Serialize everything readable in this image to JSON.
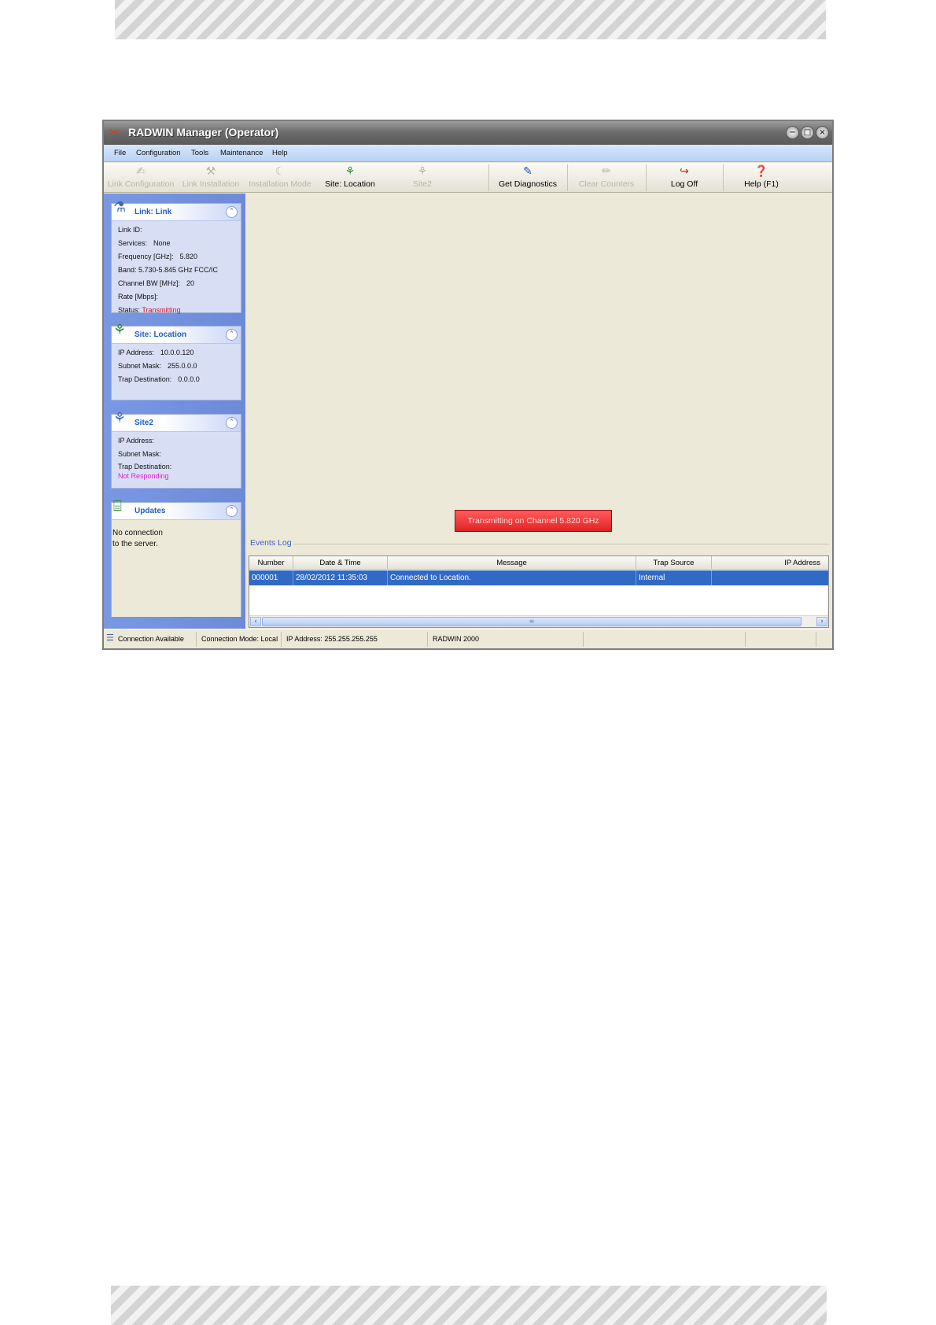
{
  "window": {
    "title": "RADWIN Manager (Operator)",
    "controls": {
      "minimize": "−",
      "maximize": "□",
      "close": "×"
    }
  },
  "menu": {
    "items": [
      "File",
      "Configuration",
      "Tools",
      "Maintenance",
      "Help"
    ]
  },
  "toolbar": {
    "buttons": [
      {
        "label": "Link Configuration",
        "enabled": false,
        "icon": "link-config-icon"
      },
      {
        "label": "Link Installation",
        "enabled": false,
        "icon": "link-install-icon"
      },
      {
        "label": "Installation Mode",
        "enabled": false,
        "icon": "installation-mode-icon"
      },
      {
        "label": "Site: Location",
        "enabled": true,
        "icon": "site-icon"
      },
      {
        "label": "Site2",
        "enabled": false,
        "icon": "site2-icon"
      },
      {
        "label": "Get Diagnostics",
        "enabled": true,
        "icon": "diagnostics-icon"
      },
      {
        "label": "Clear Counters",
        "enabled": false,
        "icon": "eraser-icon"
      },
      {
        "label": "Log Off",
        "enabled": true,
        "icon": "log-off-icon"
      },
      {
        "label": "Help (F1)",
        "enabled": true,
        "icon": "help-icon"
      }
    ]
  },
  "sidebar": {
    "link_panel": {
      "title": "Link: Link",
      "rows": [
        {
          "label": "Link ID:",
          "value": ""
        },
        {
          "label": "Services:",
          "value": "None"
        },
        {
          "label": "Frequency [GHz]:",
          "value": "5.820"
        },
        {
          "label": "Band: 5.730-5.845 GHz FCC/IC",
          "value": ""
        },
        {
          "label": "Channel BW [MHz]:",
          "value": "20"
        },
        {
          "label": "Rate [Mbps]:",
          "value": ""
        }
      ],
      "status_label": "Status:",
      "status_value": "Transmitting"
    },
    "site_panel": {
      "title": "Site: Location",
      "rows": [
        {
          "label": "IP Address:",
          "value": "10.0.0.120"
        },
        {
          "label": "Subnet Mask:",
          "value": "255.0.0.0"
        },
        {
          "label": "Trap Destination:",
          "value": "0.0.0.0"
        }
      ]
    },
    "site2_panel": {
      "title": "Site2",
      "rows": [
        {
          "label": "IP Address:",
          "value": ""
        },
        {
          "label": "Subnet Mask:",
          "value": ""
        },
        {
          "label": "Trap Destination:",
          "value": ""
        }
      ],
      "status": "Not Responding"
    },
    "updates_panel": {
      "title": "Updates",
      "message_line1": "No connection",
      "message_line2": "to the server."
    }
  },
  "main": {
    "banner": "Transmitting on Channel 5.820 GHz",
    "events_log": {
      "title": "Events Log",
      "columns": [
        "Number",
        "Date & Time",
        "Message",
        "Trap Source",
        "IP Address"
      ],
      "rows": [
        {
          "number": "000001",
          "datetime": "28/02/2012 11:35:03",
          "message": "Connected to Location.",
          "trap_source": "Internal",
          "ip": ""
        }
      ]
    }
  },
  "statusbar": {
    "connection": "Connection Available",
    "mode": "Connection Mode: Local",
    "ip": "IP Address: 255.255.255.255",
    "product": "RADWIN 2000"
  },
  "colors": {
    "accent": "#316ac5",
    "status_transmitting": "#e0102a",
    "status_not_responding": "#e020c8",
    "banner": "#e02424"
  }
}
